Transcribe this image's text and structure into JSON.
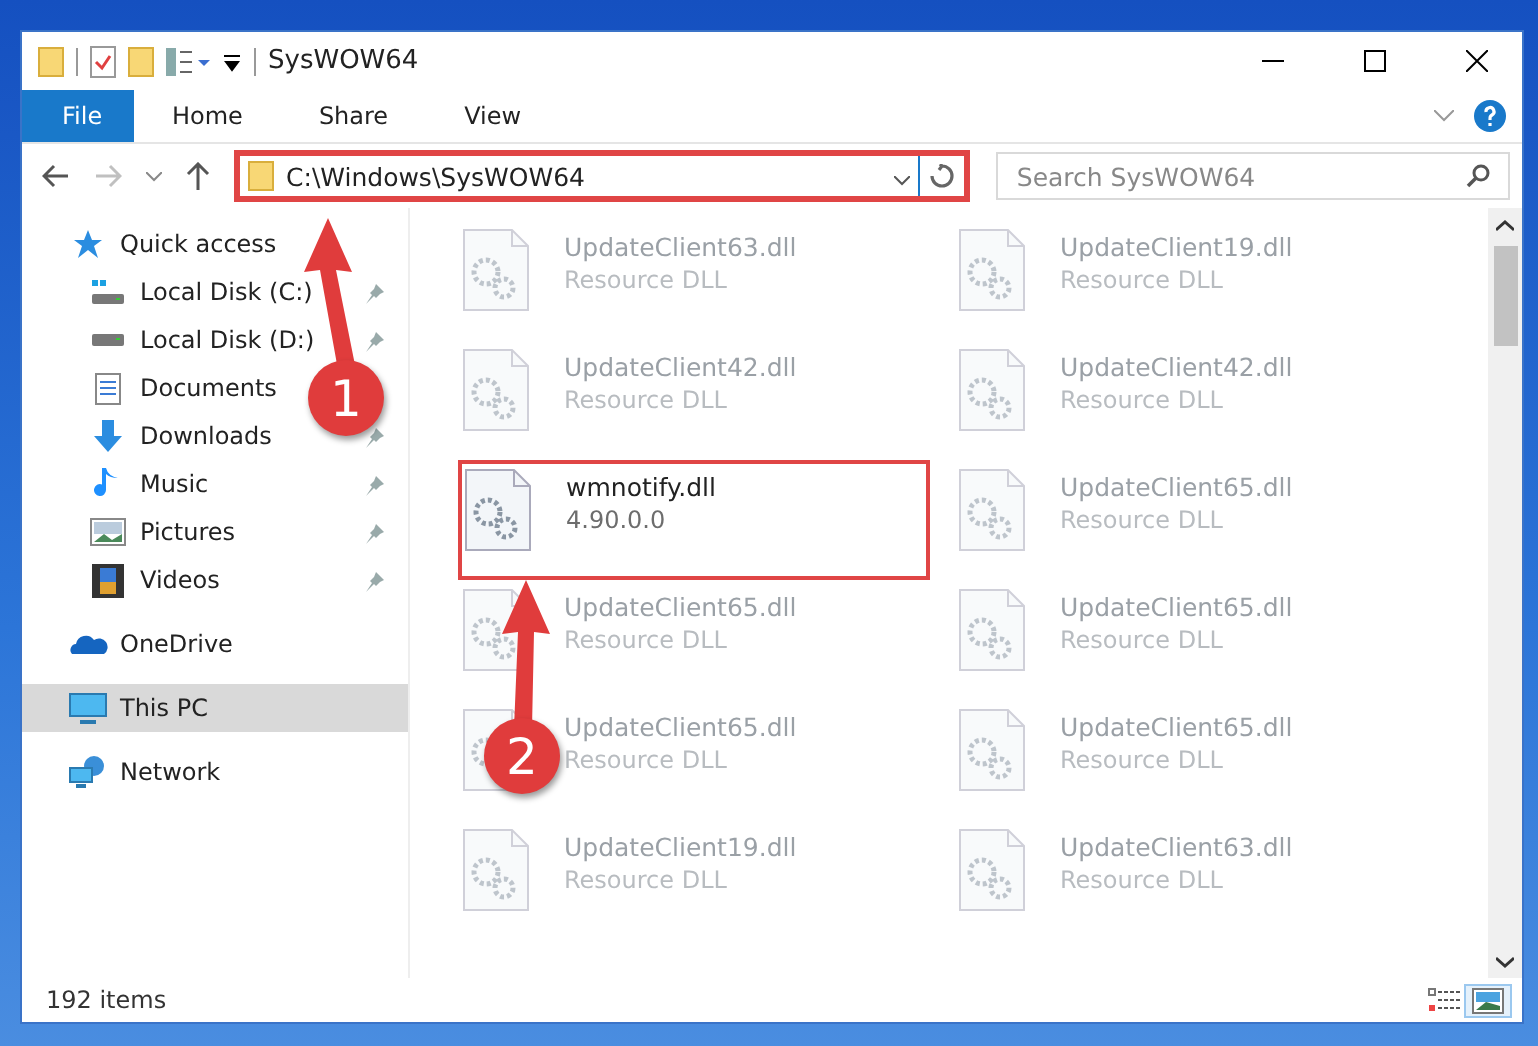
{
  "window": {
    "title": "SysWOW64"
  },
  "ribbon_tabs": [
    {
      "label": "File",
      "selected": true
    },
    {
      "label": "Home",
      "selected": false
    },
    {
      "label": "Share",
      "selected": false
    },
    {
      "label": "View",
      "selected": false
    }
  ],
  "address": {
    "path": "C:\\Windows\\SysWOW64",
    "highlighted": true
  },
  "search": {
    "placeholder": "Search SysWOW64"
  },
  "navigation": [
    {
      "label": "Quick access",
      "kind": "star",
      "selected": false,
      "children": [
        {
          "label": "Local Disk (C:)",
          "kind": "system-drive",
          "pinned": true
        },
        {
          "label": "Local Disk (D:)",
          "kind": "drive",
          "pinned": true
        },
        {
          "label": "Documents",
          "kind": "documents",
          "pinned": false
        },
        {
          "label": "Downloads",
          "kind": "downloads",
          "pinned": true
        },
        {
          "label": "Music",
          "kind": "music",
          "pinned": true
        },
        {
          "label": "Pictures",
          "kind": "pictures",
          "pinned": true
        },
        {
          "label": "Videos",
          "kind": "videos",
          "pinned": true
        }
      ]
    },
    {
      "label": "OneDrive",
      "kind": "cloud",
      "selected": false
    },
    {
      "label": "This PC",
      "kind": "computer",
      "selected": true
    },
    {
      "label": "Network",
      "kind": "network",
      "selected": false
    }
  ],
  "files": [
    {
      "name": "UpdateClient63.dll",
      "detail": "Resource DLL",
      "dimmed": true,
      "highlighted": false
    },
    {
      "name": "UpdateClient19.dll",
      "detail": "Resource DLL",
      "dimmed": true,
      "highlighted": false
    },
    {
      "name": "UpdateClient42.dll",
      "detail": "Resource DLL",
      "dimmed": true,
      "highlighted": false
    },
    {
      "name": "UpdateClient42.dll",
      "detail": "Resource DLL",
      "dimmed": true,
      "highlighted": false
    },
    {
      "name": "wmnotify.dll",
      "detail": "4.90.0.0",
      "dimmed": false,
      "highlighted": true
    },
    {
      "name": "UpdateClient65.dll",
      "detail": "Resource DLL",
      "dimmed": true,
      "highlighted": false
    },
    {
      "name": "UpdateClient65.dll",
      "detail": "Resource DLL",
      "dimmed": true,
      "highlighted": false
    },
    {
      "name": "UpdateClient65.dll",
      "detail": "Resource DLL",
      "dimmed": true,
      "highlighted": false
    },
    {
      "name": "UpdateClient65.dll",
      "detail": "Resource DLL",
      "dimmed": true,
      "highlighted": false
    },
    {
      "name": "UpdateClient65.dll",
      "detail": "Resource DLL",
      "dimmed": true,
      "highlighted": false
    },
    {
      "name": "UpdateClient19.dll",
      "detail": "Resource DLL",
      "dimmed": true,
      "highlighted": false
    },
    {
      "name": "UpdateClient63.dll",
      "detail": "Resource DLL",
      "dimmed": true,
      "highlighted": false
    }
  ],
  "status_bar": {
    "item_count": "192 items"
  },
  "view_buttons": [
    {
      "kind": "details",
      "selected": false
    },
    {
      "kind": "large-icons",
      "selected": true
    }
  ],
  "annotations": [
    {
      "label": "1"
    },
    {
      "label": "2"
    }
  ]
}
